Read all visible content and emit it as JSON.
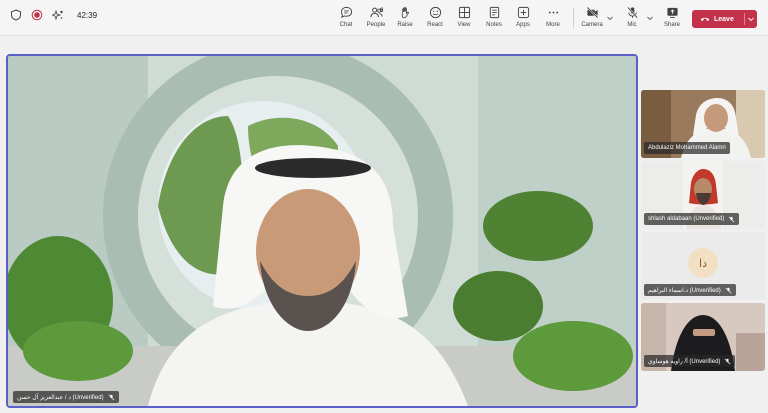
{
  "meeting": {
    "timer": "42:39"
  },
  "toolbar": {
    "chat": "Chat",
    "people": "People",
    "people_count": "6",
    "raise": "Raise",
    "react": "React",
    "view": "View",
    "notes": "Notes",
    "apps": "Apps",
    "more": "More",
    "camera": "Camera",
    "mic": "Mic",
    "share": "Share",
    "leave": "Leave"
  },
  "main_video": {
    "participant_name": "د / عبدالعزيز آل حسن (Unverified)"
  },
  "participants": [
    {
      "name": "Abdulaziz Mohammed Alamri"
    },
    {
      "name": "shlash aldabaan (Unverified)"
    },
    {
      "name": "د.اسماء البراهيم (Unverified)",
      "initials": "دا"
    },
    {
      "name": "أ/ راويه هوساوي (Unverified)"
    }
  ],
  "colors": {
    "leave": "#c4314b",
    "active_speaker_border": "#5b5fc7",
    "avatar_bg": "#f3dfc4"
  }
}
